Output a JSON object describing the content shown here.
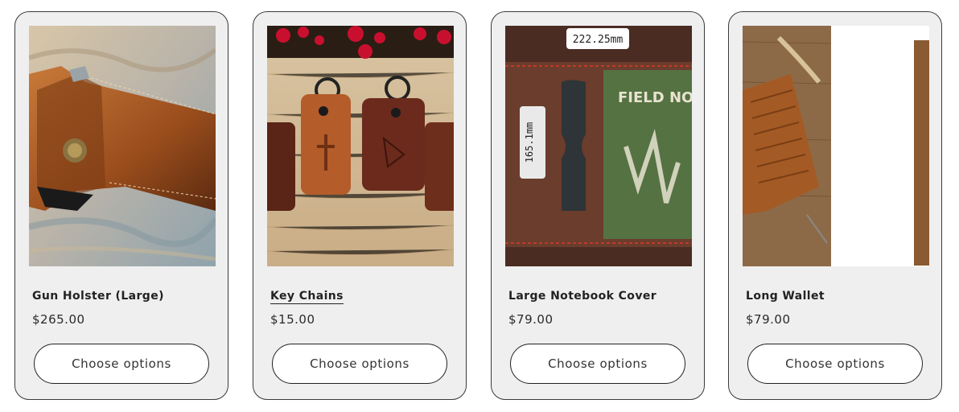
{
  "products": [
    {
      "title": "Gun Holster (Large)",
      "price": "$265.00",
      "button_label": "Choose options",
      "image_icon": "leather-holster-photo"
    },
    {
      "title": "Key Chains",
      "price": "$15.00",
      "button_label": "Choose options",
      "image_icon": "leather-keychains-photo"
    },
    {
      "title": "Large Notebook Cover",
      "price": "$79.00",
      "button_label": "Choose options",
      "image_icon": "notebook-cover-photo",
      "image_text": {
        "width_label": "222.25mm",
        "height_label": "165.1mm",
        "book_title": "FIELD NOTES"
      }
    },
    {
      "title": "Long Wallet",
      "price": "$79.00",
      "button_label": "Choose options",
      "image_icon": "long-wallet-photo"
    }
  ],
  "colors": {
    "card_bg": "#efefef",
    "card_border": "#3a3a3a",
    "button_bg": "#ffffff",
    "text": "#222222"
  }
}
